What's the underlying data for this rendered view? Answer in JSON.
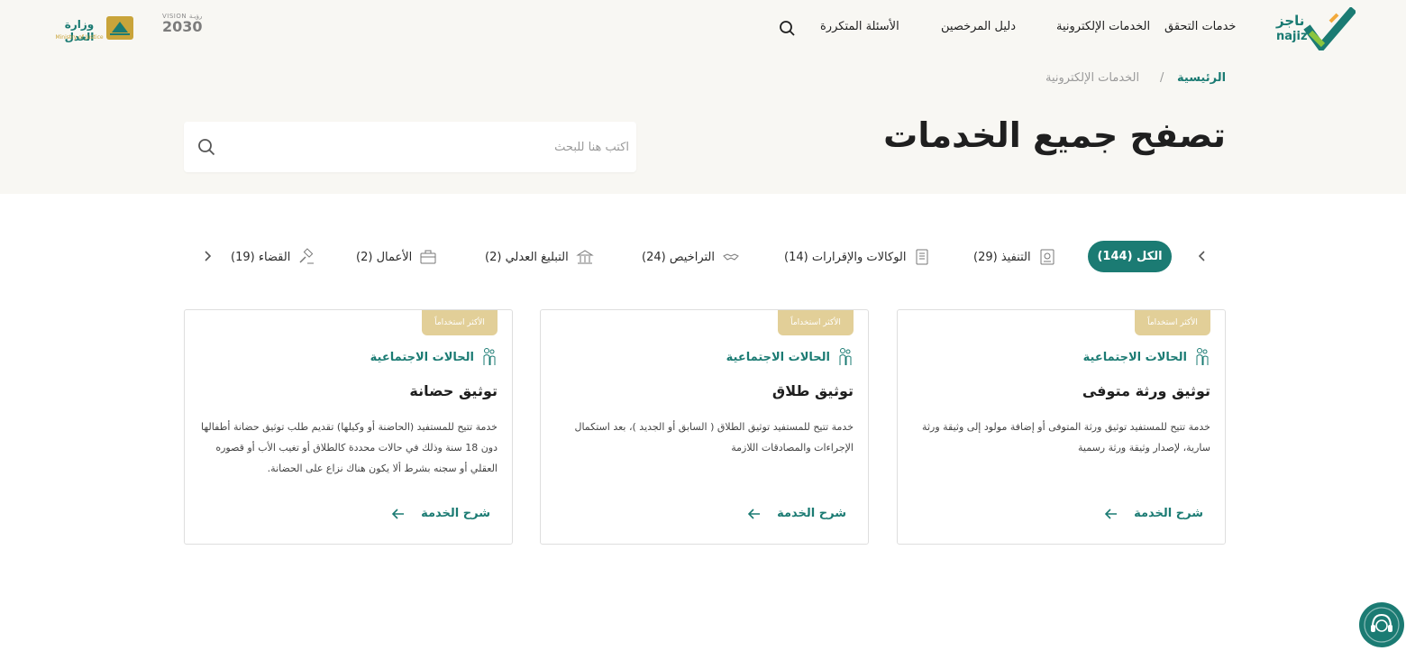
{
  "header": {
    "logo_text": "ناجز",
    "logo_sub": "najiz",
    "nav": [
      {
        "label": "خدمات التحقق"
      },
      {
        "label": "الخدمات الإلكترونية"
      },
      {
        "label": "دليل المرخصين"
      },
      {
        "label": "الأسئلة المتكررة"
      }
    ],
    "vision_small": "VISION رؤيـة",
    "vision_year": "2030",
    "ministry": "وزارة العدل",
    "ministry_en": "Ministry of Justice"
  },
  "breadcrumb": {
    "home": "الرئيسية",
    "separator": "/",
    "current": "الخدمات الإلكترونية"
  },
  "page_title": "تصفح جميع الخدمات",
  "search": {
    "placeholder": "اكتب هنا للبحث"
  },
  "tabs": [
    {
      "label": "الكل (144)",
      "active": true
    },
    {
      "label": "التنفيذ (29)",
      "icon": "document-check-icon"
    },
    {
      "label": "الوكالات والإقرارات (14)",
      "icon": "document-list-icon"
    },
    {
      "label": "التراخيص (24)",
      "icon": "handshake-icon"
    },
    {
      "label": "التبليغ العدلي (2)",
      "icon": "building-icon"
    },
    {
      "label": "الأعمال (2)",
      "icon": "briefcase-icon"
    },
    {
      "label": "القضاء (19)",
      "icon": "gavel-icon"
    }
  ],
  "cards": [
    {
      "badge": "الأكثر استخداماً",
      "category": "الحالات الاجتماعية",
      "title": "توثيق ورثة متوفى",
      "description": "خدمة تتيح للمستفيد توثيق ورثة المتوفى أو إضافة مولود إلى وثيقة ورثة سارية، لإصدار وثيقة ورثة رسمية",
      "link": "شرح الخدمة"
    },
    {
      "badge": "الأكثر استخداماً",
      "category": "الحالات الاجتماعية",
      "title": "توثيق طلاق",
      "description": "خدمة تتيح للمستفيد توثيق الطلاق ( السابق أو الجديد )، بعد استكمال الإجراءات والمصادقات اللازمة",
      "link": "شرح الخدمة"
    },
    {
      "badge": "الأكثر استخداماً",
      "category": "الحالات الاجتماعية",
      "title": "توثيق حضانة",
      "description": "خدمة تتيح للمستفيد (الحاضنة أو وكيلها) تقديم طلب توثيق حضانة أطفالها دون 18 سنة وذلك في حالات محددة كالطلاق أو تغيب الأب أو قصوره العقلي أو سجنه بشرط ألا يكون هناك نزاع على الحضانة.",
      "link": "شرح الخدمة"
    }
  ],
  "colors": {
    "primary": "#1b7b73",
    "badge": "#e2cf98",
    "hero_bg": "#f8f7f3"
  }
}
